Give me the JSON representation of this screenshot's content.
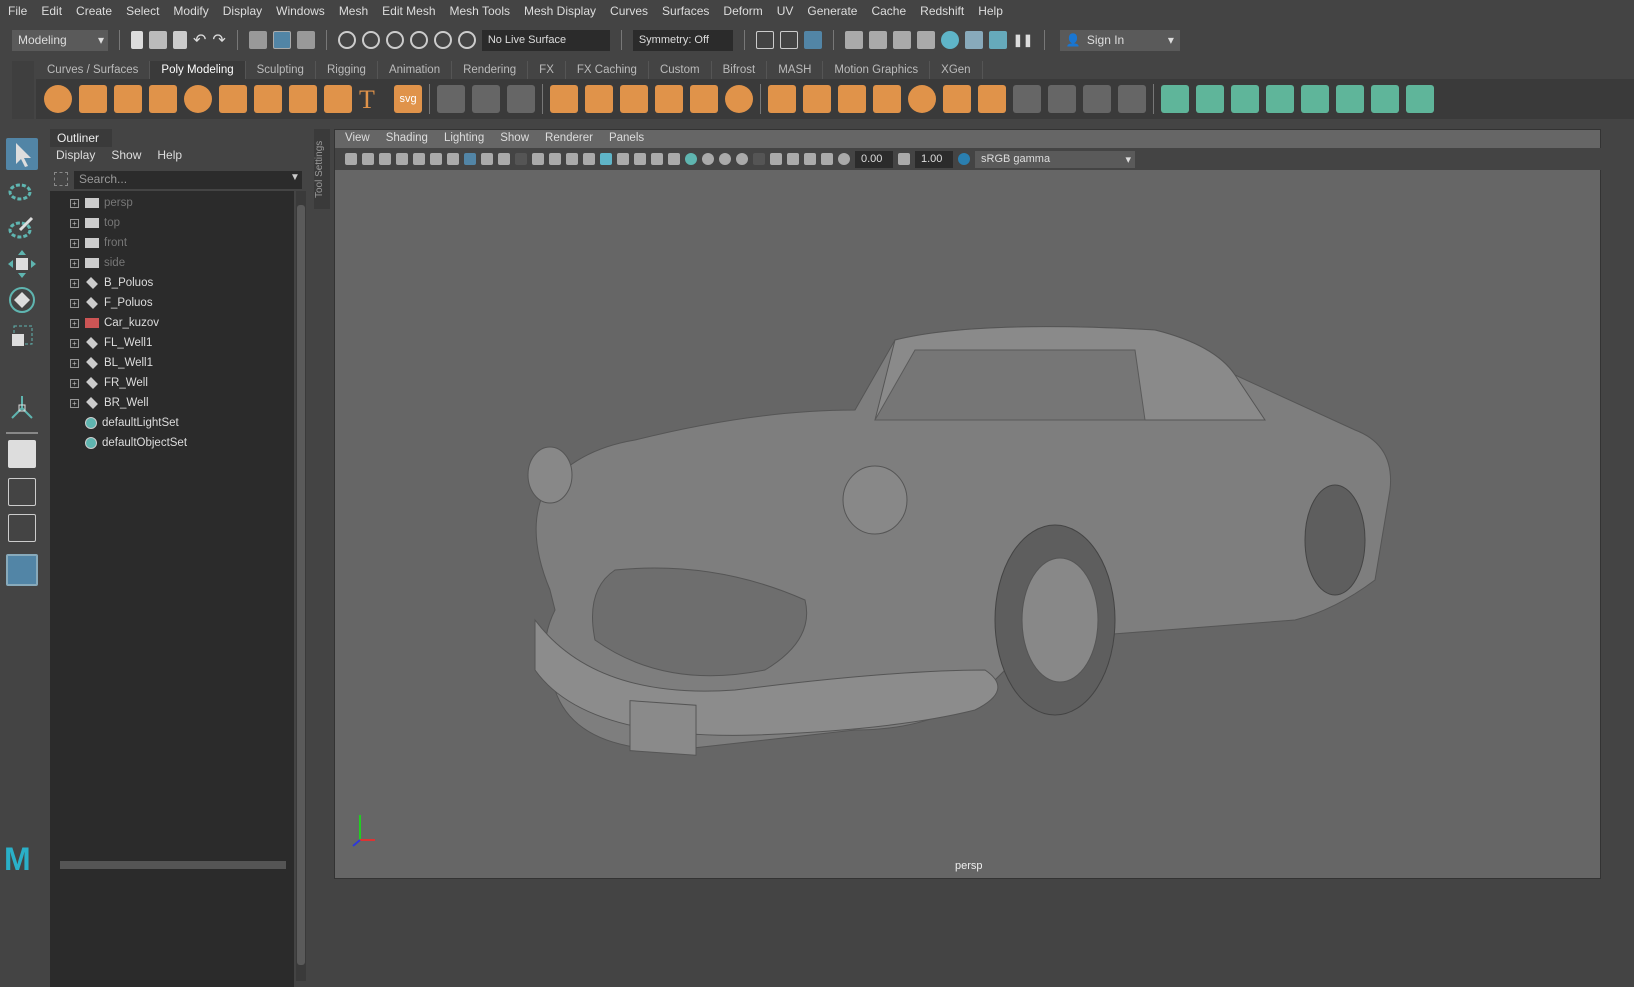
{
  "menubar": [
    "File",
    "Edit",
    "Create",
    "Select",
    "Modify",
    "Display",
    "Windows",
    "Mesh",
    "Edit Mesh",
    "Mesh Tools",
    "Mesh Display",
    "Curves",
    "Surfaces",
    "Deform",
    "UV",
    "Generate",
    "Cache",
    "Redshift",
    "Help"
  ],
  "status": {
    "menuset": "Modeling",
    "live_surface": "No Live Surface",
    "symmetry": "Symmetry: Off",
    "sign_in": "Sign In"
  },
  "shelf": {
    "tabs": [
      "Curves / Surfaces",
      "Poly Modeling",
      "Sculpting",
      "Rigging",
      "Animation",
      "Rendering",
      "FX",
      "FX Caching",
      "Custom",
      "Bifrost",
      "MASH",
      "Motion Graphics",
      "XGen"
    ],
    "active": "Poly Modeling",
    "icons": [
      "poly-sphere",
      "poly-cube",
      "poly-cylinder",
      "poly-cone",
      "poly-torus",
      "poly-plane",
      "poly-disc",
      "platonic-solid",
      "super-shape",
      "type",
      "svg",
      "measure",
      "reset-transform",
      "freeze-transform",
      "combine",
      "separate",
      "mirror",
      "smooth",
      "extract",
      "booleans",
      "bevel-cube",
      "bridge",
      "fill-hole",
      "bevel",
      "bevel-sphere",
      "extrude",
      "append",
      "insert-edge-loop",
      "multi-cut",
      "offset-edge",
      "slide-edge",
      "uv-planar",
      "uv-cylindrical",
      "uv-spherical",
      "uv-automatic",
      "uv-contour",
      "uv-editor",
      "uv-cut",
      "uv-sew"
    ],
    "svg_label": "svg"
  },
  "outliner": {
    "tab": "Outliner",
    "menus": [
      "Display",
      "Show",
      "Help"
    ],
    "search_placeholder": "Search...",
    "items": [
      {
        "name": "persp",
        "type": "camera"
      },
      {
        "name": "top",
        "type": "camera"
      },
      {
        "name": "front",
        "type": "camera"
      },
      {
        "name": "side",
        "type": "camera"
      },
      {
        "name": "B_Poluos",
        "type": "group"
      },
      {
        "name": "F_Poluos",
        "type": "group"
      },
      {
        "name": "Car_kuzov",
        "type": "mesh"
      },
      {
        "name": "FL_Well1",
        "type": "group"
      },
      {
        "name": "BL_Well1",
        "type": "group"
      },
      {
        "name": "FR_Well",
        "type": "group"
      },
      {
        "name": "BR_Well",
        "type": "group"
      },
      {
        "name": "defaultLightSet",
        "type": "set"
      },
      {
        "name": "defaultObjectSet",
        "type": "set"
      }
    ]
  },
  "tool_settings": "Tool Settings",
  "viewport": {
    "menus": [
      "View",
      "Shading",
      "Lighting",
      "Show",
      "Renderer",
      "Panels"
    ],
    "exposure": "0.00",
    "gamma": "1.00",
    "color_space": "sRGB gamma",
    "camera": "persp"
  },
  "colors": {
    "orange": "#e0934a",
    "teal": "#5fb59a",
    "highlight": "#5285a6"
  }
}
